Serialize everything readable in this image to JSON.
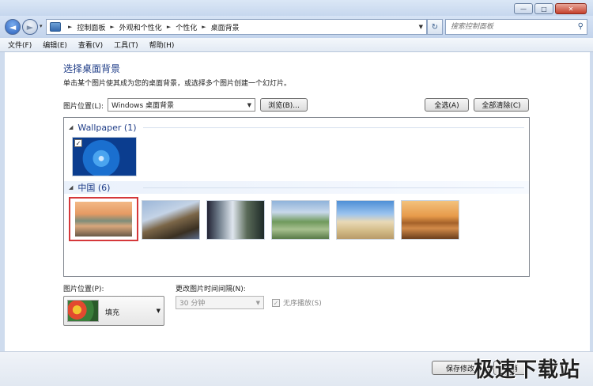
{
  "window": {
    "minimize": "—",
    "maximize": "□",
    "close": "✕"
  },
  "nav": {
    "back": "◄",
    "forward": "►",
    "history": "▾",
    "breadcrumb": [
      "控制面板",
      "外观和个性化",
      "个性化",
      "桌面背景"
    ],
    "refresh": "↻",
    "search_placeholder": "搜索控制面板"
  },
  "menu": [
    "文件(F)",
    "编辑(E)",
    "查看(V)",
    "工具(T)",
    "帮助(H)"
  ],
  "main": {
    "heading": "选择桌面背景",
    "subtext": "单击某个图片使其成为您的桌面背景，或选择多个图片创建一个幻灯片。",
    "location_label": "图片位置(L):",
    "location_value": "Windows 桌面背景",
    "browse": "浏览(B)...",
    "select_all": "全选(A)",
    "clear_all": "全部清除(C)"
  },
  "gallery": {
    "groups": [
      {
        "title": "Wallpaper (1)"
      },
      {
        "title": "中国 (6)"
      }
    ],
    "checkmark": "✓"
  },
  "bottom": {
    "position_label": "图片位置(P):",
    "position_value": "填充",
    "interval_label": "更改图片时间间隔(N):",
    "interval_value": "30 分钟",
    "shuffle_label": "无序播放(S)",
    "shuffle_check": "✓"
  },
  "footer": {
    "save": "保存修改",
    "cancel": "取消",
    "watermark": "极速下载站"
  },
  "colors": {
    "heading": "#1e3c87",
    "selection": "#d5383a"
  }
}
